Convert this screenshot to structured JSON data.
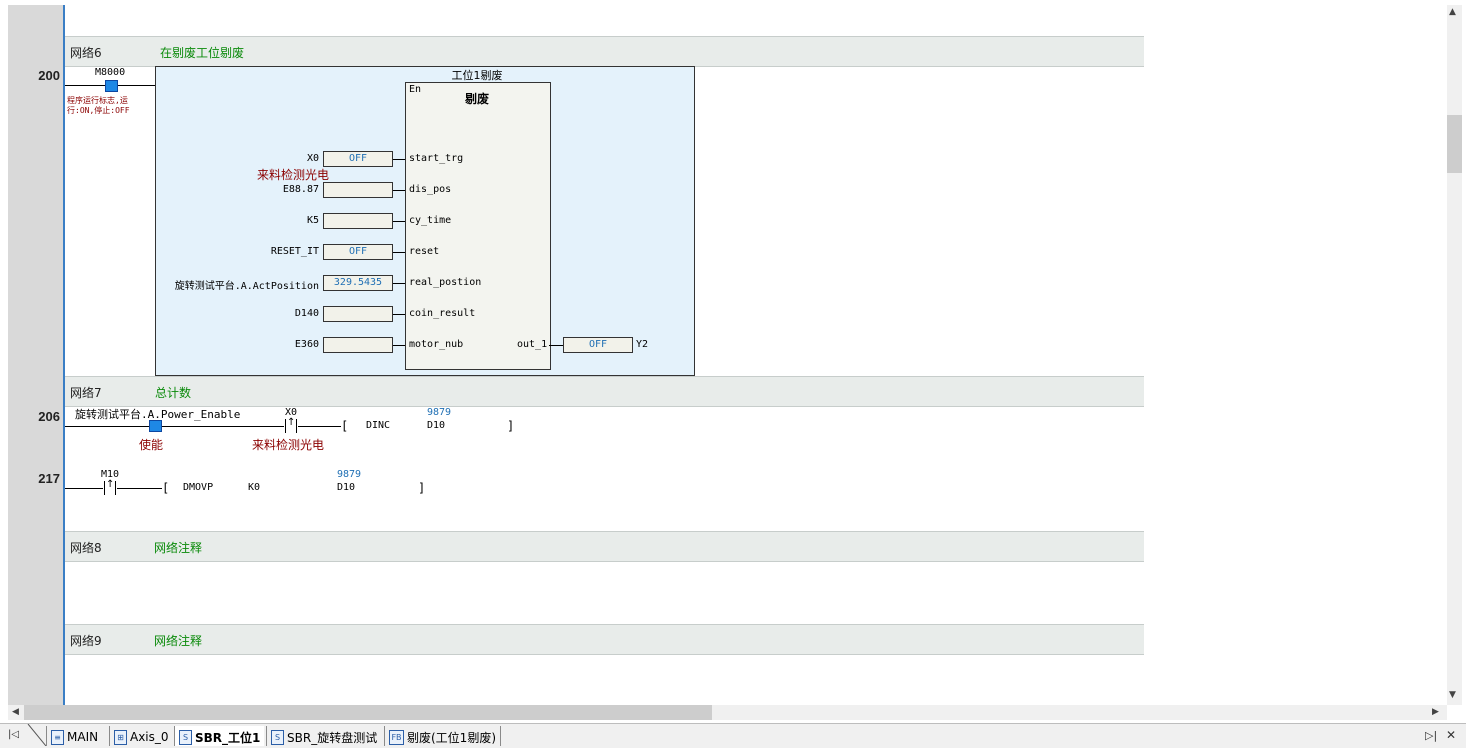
{
  "networks": [
    {
      "name": "网络6",
      "comment": "在剔废工位剔废"
    },
    {
      "name": "网络7",
      "comment": "总计数"
    },
    {
      "name": "网络8",
      "comment": "网络注释"
    },
    {
      "name": "网络9",
      "comment": "网络注释"
    }
  ],
  "steps": [
    "200",
    "206",
    "217"
  ],
  "rung200": {
    "contact": "M8000",
    "contact_comment": "程序运行标志,运行:ON,停止:OFF",
    "fb_instance": "工位1剔废",
    "fb_type": "剔废",
    "en_label": "En",
    "inputs": [
      {
        "operand": "X0",
        "value": "OFF",
        "pin": "start_trg",
        "comment": "来料检测光电"
      },
      {
        "operand": "E88.87",
        "value": "",
        "pin": "dis_pos",
        "comment": ""
      },
      {
        "operand": "K5",
        "value": "",
        "pin": "cy_time",
        "comment": ""
      },
      {
        "operand": "RESET_IT",
        "value": "OFF",
        "pin": "reset",
        "comment": ""
      },
      {
        "operand": "旋转测试平台.A.ActPosition",
        "value": "329.5435",
        "pin": "real_postion",
        "comment": ""
      },
      {
        "operand": "D140",
        "value": "",
        "pin": "coin_result",
        "comment": ""
      },
      {
        "operand": "E360",
        "value": "",
        "pin": "motor_nub",
        "comment": ""
      }
    ],
    "output": {
      "pin": "out_1",
      "value": "OFF",
      "operand": "Y2"
    }
  },
  "rung206": {
    "contact1": "旋转测试平台.A.Power_Enable",
    "contact1_comment": "使能",
    "contact2": "X0",
    "contact2_comment": "来料检测光电",
    "instr": "DINC",
    "operand": "D10",
    "operand_value": "9879"
  },
  "rung217": {
    "contact": "M10",
    "instr": "DMOVP",
    "src": "K0",
    "dst": "D10",
    "dst_value": "9879"
  },
  "tabs": [
    {
      "label": "MAIN",
      "icon": "ladder-icon",
      "active": false
    },
    {
      "label": "Axis_0",
      "icon": "axis-icon",
      "active": false
    },
    {
      "label": "SBR_工位1",
      "icon": "subroutine-icon",
      "active": true
    },
    {
      "label": "SBR_旋转盘测试",
      "icon": "subroutine-icon",
      "active": false
    },
    {
      "label": "剔废(工位1剔废)",
      "icon": "fb-icon",
      "active": false
    }
  ],
  "scroll_arrows": {
    "up": "▲",
    "down": "▼",
    "left": "◀",
    "right": "▶"
  },
  "window_controls": {
    "nav": "▷|",
    "close": "✕"
  },
  "colors": {
    "accent": "#3a7ec5",
    "comment_green": "#0a8a0a",
    "comment_red": "#8b0000",
    "value_blue": "#1f6fb4",
    "fb_background": "#e4f2fb"
  }
}
